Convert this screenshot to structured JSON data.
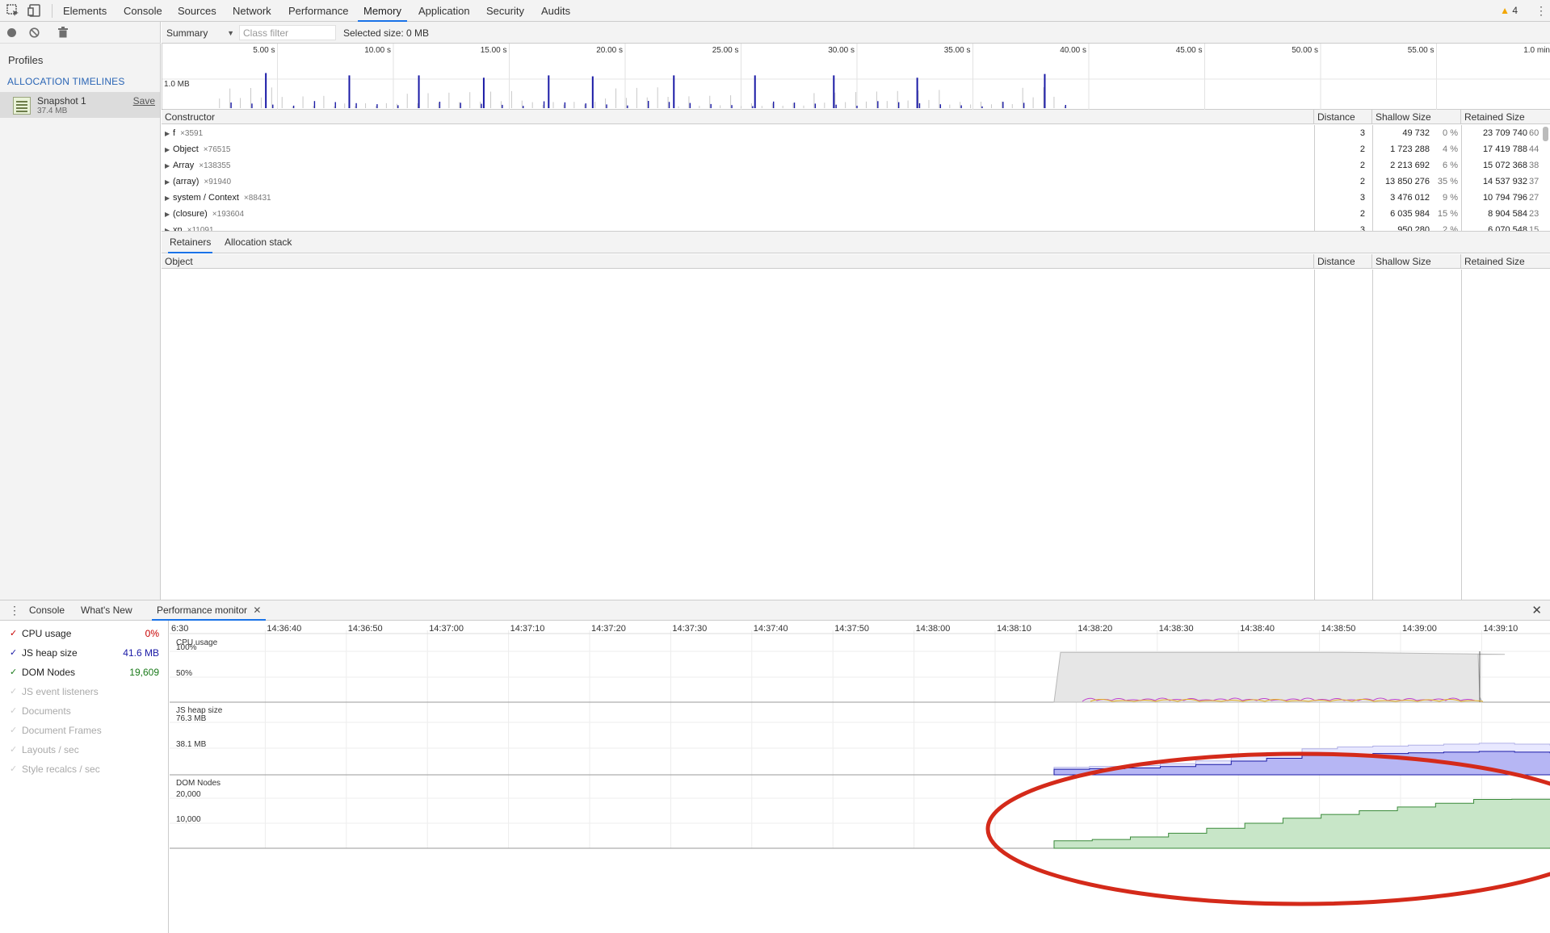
{
  "devtools": {
    "tabs": [
      "Elements",
      "Console",
      "Sources",
      "Network",
      "Performance",
      "Memory",
      "Application",
      "Security",
      "Audits"
    ],
    "active_tab": "Memory",
    "warning_count": "4"
  },
  "profiles": {
    "heading": "Profiles",
    "section": "ALLOCATION TIMELINES",
    "snapshot": {
      "name": "Snapshot 1",
      "size": "37.4 MB",
      "save_label": "Save"
    }
  },
  "memory_toolbar": {
    "view": "Summary",
    "class_filter_placeholder": "Class filter",
    "selected_size": "Selected size: 0 MB"
  },
  "allocation_timeline": {
    "time_ticks": [
      "5.00 s",
      "10.00 s",
      "15.00 s",
      "20.00 s",
      "25.00 s",
      "30.00 s",
      "35.00 s",
      "40.00 s",
      "45.00 s",
      "50.00 s",
      "55.00 s",
      "1.0 min"
    ],
    "scale_label": "1.0 MB",
    "spike_times_s": [
      4.5,
      8.1,
      11.1,
      13.9,
      16.7,
      18.6,
      22.1,
      25.6,
      29.0,
      32.6,
      38.1
    ],
    "spike_mb": [
      0.75,
      0.7,
      0.7,
      0.65,
      0.7,
      0.68,
      0.7,
      0.7,
      0.7,
      0.65,
      0.73
    ]
  },
  "constructor_grid": {
    "headers": {
      "name": "Constructor",
      "distance": "Distance",
      "shallow": "Shallow Size",
      "retained": "Retained Size"
    },
    "rows": [
      {
        "name": "f",
        "count": "×3591",
        "distance": "3",
        "shallow": "49 732",
        "shallow_pct": "0 %",
        "retained": "23 709 740",
        "retained_pct": "60"
      },
      {
        "name": "Object",
        "count": "×76515",
        "distance": "2",
        "shallow": "1 723 288",
        "shallow_pct": "4 %",
        "retained": "17 419 788",
        "retained_pct": "44"
      },
      {
        "name": "Array",
        "count": "×138355",
        "distance": "2",
        "shallow": "2 213 692",
        "shallow_pct": "6 %",
        "retained": "15 072 368",
        "retained_pct": "38"
      },
      {
        "name": "(array)",
        "count": "×91940",
        "distance": "2",
        "shallow": "13 850 276",
        "shallow_pct": "35 %",
        "retained": "14 537 932",
        "retained_pct": "37"
      },
      {
        "name": "system / Context",
        "count": "×88431",
        "distance": "3",
        "shallow": "3 476 012",
        "shallow_pct": "9 %",
        "retained": "10 794 796",
        "retained_pct": "27"
      },
      {
        "name": "(closure)",
        "count": "×193604",
        "distance": "2",
        "shallow": "6 035 984",
        "shallow_pct": "15 %",
        "retained": "8 904 584",
        "retained_pct": "23"
      },
      {
        "name": "xn",
        "count": "×11091",
        "distance": "3",
        "shallow": "950 280",
        "shallow_pct": "2 %",
        "retained": "6 070 548",
        "retained_pct": "15"
      }
    ]
  },
  "retainers": {
    "tabs": [
      "Retainers",
      "Allocation stack"
    ],
    "headers": {
      "name": "Object",
      "distance": "Distance",
      "shallow": "Shallow Size",
      "retained": "Retained Size"
    }
  },
  "drawer": {
    "tabs": [
      "Console",
      "What's New",
      "Performance monitor"
    ],
    "active_tab": "Performance monitor"
  },
  "performance_monitor": {
    "metrics": [
      {
        "label": "CPU usage",
        "value": "0%",
        "enabled": true,
        "color": "#c80000"
      },
      {
        "label": "JS heap size",
        "value": "41.6 MB",
        "enabled": true,
        "color": "#1a1aa6"
      },
      {
        "label": "DOM Nodes",
        "value": "19,609",
        "enabled": true,
        "color": "#1a7a1a"
      },
      {
        "label": "JS event listeners",
        "value": "",
        "enabled": false
      },
      {
        "label": "Documents",
        "value": "",
        "enabled": false
      },
      {
        "label": "Document Frames",
        "value": "",
        "enabled": false
      },
      {
        "label": "Layouts / sec",
        "value": "",
        "enabled": false
      },
      {
        "label": "Style recalcs / sec",
        "value": "",
        "enabled": false
      }
    ],
    "time_ticks": [
      "6:30",
      "14:36:40",
      "14:36:50",
      "14:37:00",
      "14:37:10",
      "14:37:20",
      "14:37:30",
      "14:37:40",
      "14:37:50",
      "14:38:00",
      "14:38:10",
      "14:38:20",
      "14:38:30",
      "14:38:40",
      "14:38:50",
      "14:39:00",
      "14:39:10",
      "14:39:"
    ],
    "cpu": {
      "title": "CPU usage",
      "scale": [
        "100%",
        "50%"
      ]
    },
    "heap": {
      "title": "JS heap size",
      "scale": [
        "76.3 MB",
        "38.1 MB"
      ]
    },
    "dom": {
      "title": "DOM Nodes",
      "scale": [
        "20,000",
        "10,000"
      ]
    },
    "cpu_series_pct": [
      0,
      98,
      98,
      98,
      98,
      98,
      98,
      98,
      98,
      97,
      96,
      95,
      94,
      10,
      0
    ],
    "heap_series_mb": [
      8,
      9,
      10,
      12,
      15,
      20,
      24,
      28,
      30,
      31,
      32,
      33,
      34,
      33,
      32
    ],
    "dom_series_nodes": [
      3000,
      3500,
      4500,
      6000,
      8000,
      10000,
      12000,
      13500,
      15000,
      16500,
      18000,
      19500,
      19609,
      19609
    ]
  },
  "annotation": {
    "color": "#d42a1a"
  }
}
